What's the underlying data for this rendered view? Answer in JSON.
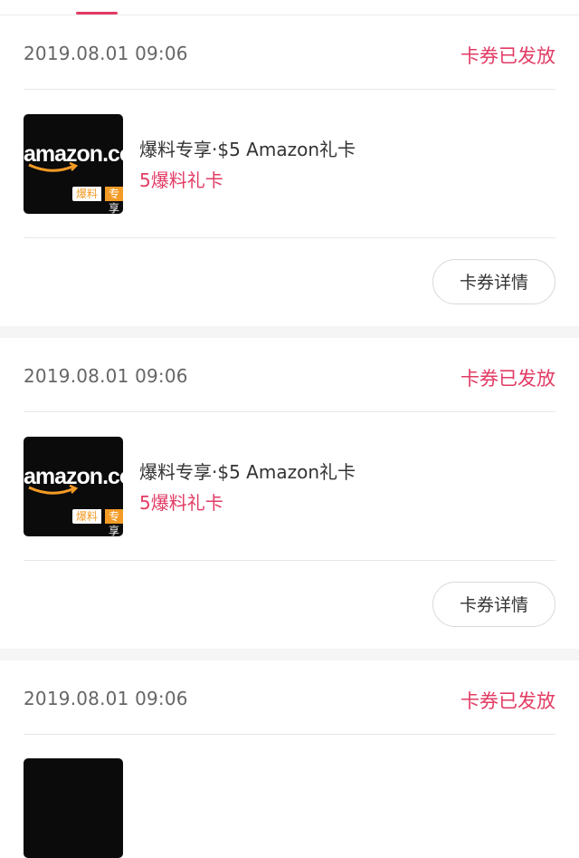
{
  "colors": {
    "accent": "#e23b64",
    "thumb_bg": "#0b0b0b",
    "tag_orange": "#f39b26"
  },
  "orders": [
    {
      "date": "2019.08.01  09:06",
      "status": "卡券已发放",
      "product_title": "爆料专享·$5 Amazon礼卡",
      "product_subtitle": "5爆料礼卡",
      "thumb": {
        "logo_text": "amazon.com",
        "tag1": "爆料",
        "tag2": "专享",
        "icon": "amazon-logo-icon"
      },
      "detail_button": "卡券详情"
    },
    {
      "date": "2019.08.01  09:06",
      "status": "卡券已发放",
      "product_title": "爆料专享·$5 Amazon礼卡",
      "product_subtitle": "5爆料礼卡",
      "thumb": {
        "logo_text": "amazon.com",
        "tag1": "爆料",
        "tag2": "专享",
        "icon": "amazon-logo-icon"
      },
      "detail_button": "卡券详情"
    },
    {
      "date": "2019.08.01  09:06",
      "status": "卡券已发放"
    }
  ]
}
